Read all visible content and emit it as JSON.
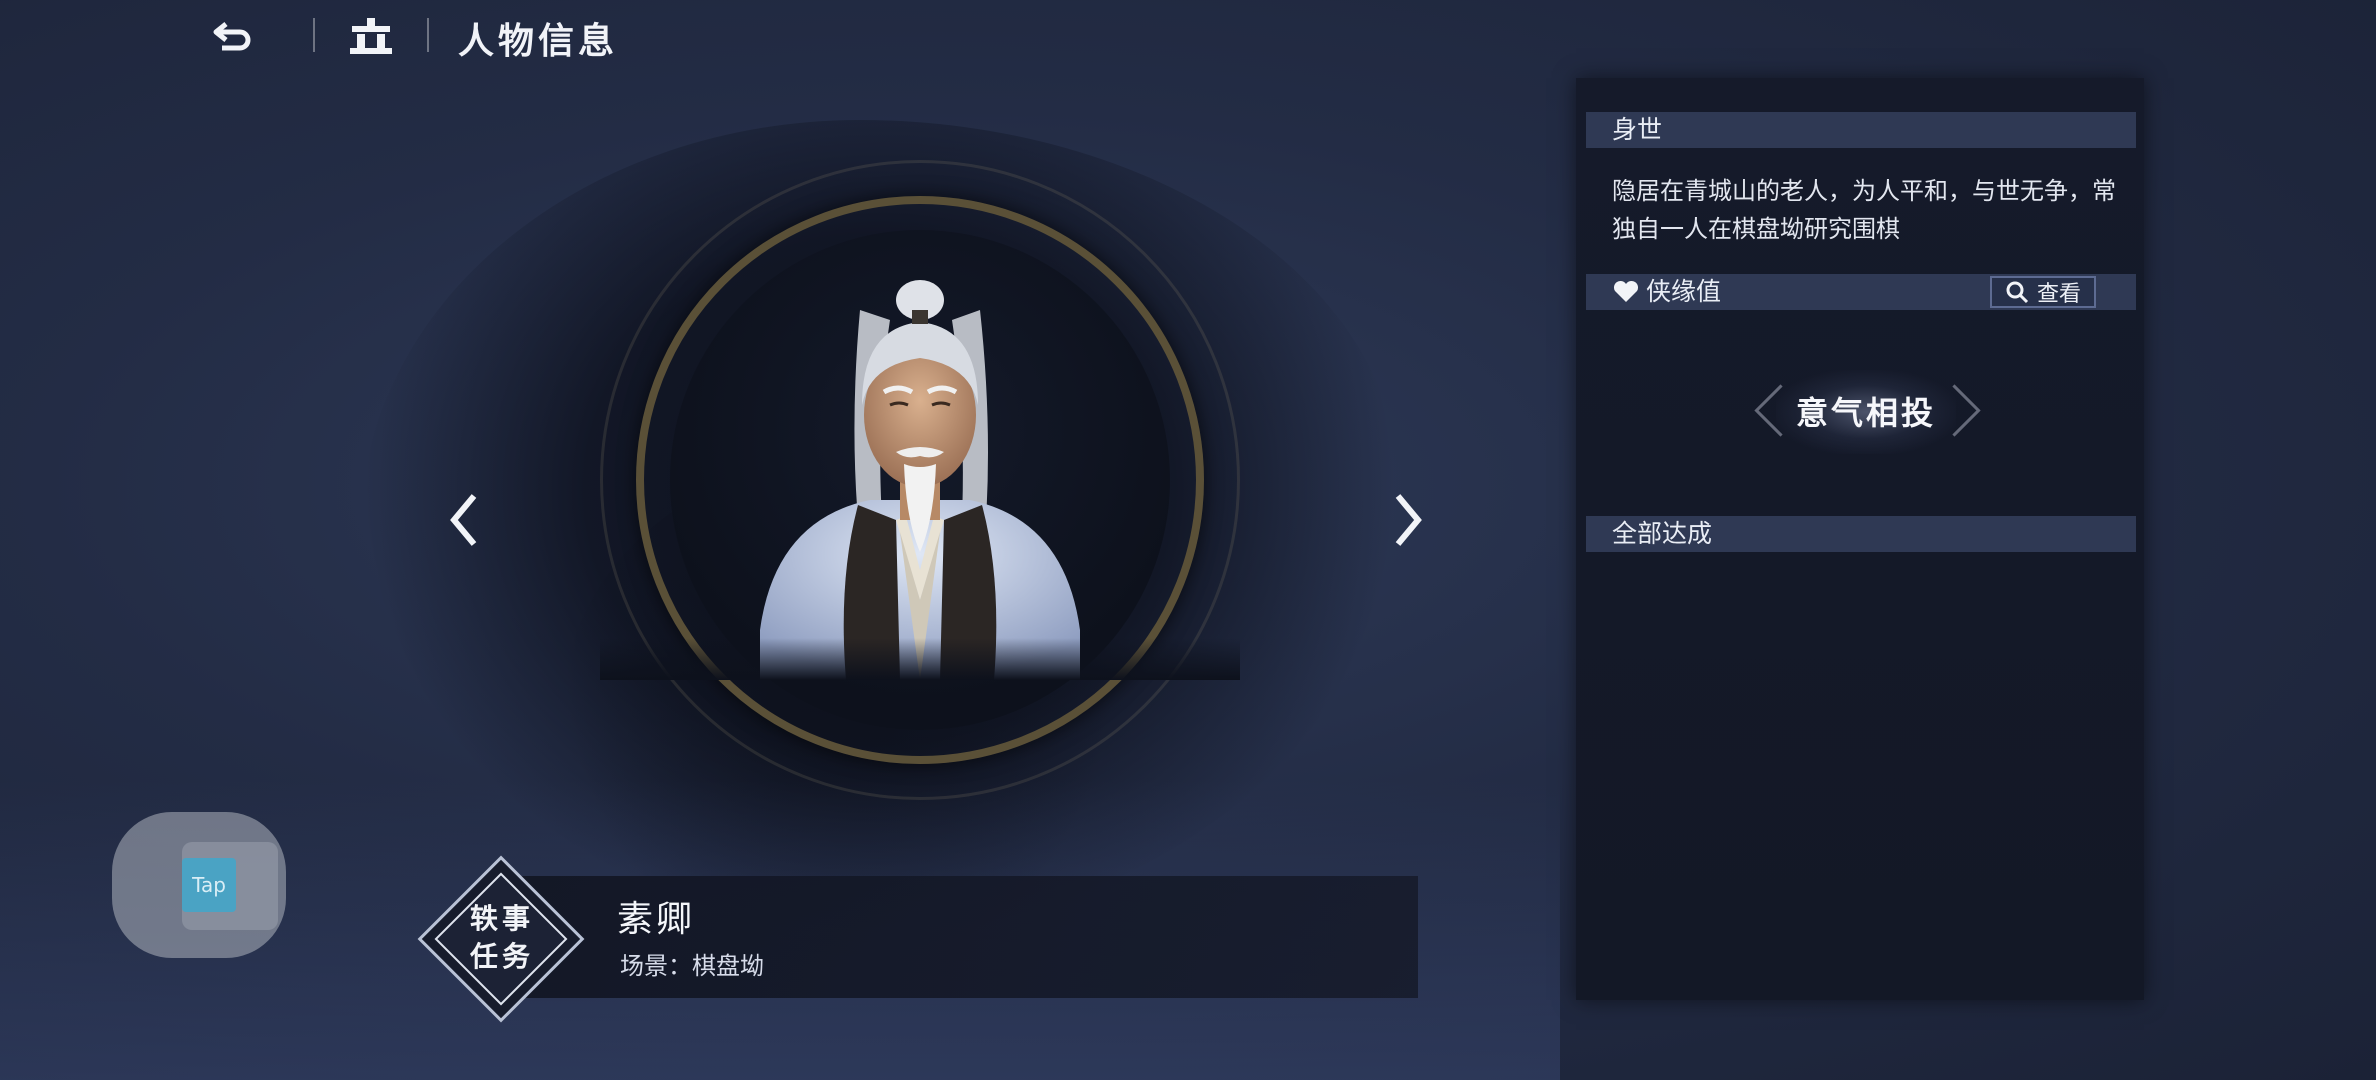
{
  "header": {
    "title": "人物信息"
  },
  "character": {
    "name": "素卿",
    "scene": "场景：棋盘坳"
  },
  "quest_badge": {
    "line1": "轶事",
    "line2": "任务"
  },
  "floating_button": {
    "label": "Tap"
  },
  "panel": {
    "bio_title": "身世",
    "bio_text": "隐居在青城山的老人，为人平和，与世无争，常独自一人在棋盘坳研究围棋",
    "affinity_label": "侠缘值",
    "view_label": "查看",
    "relationship": "意气相投",
    "completion_label": "全部达成"
  },
  "colors": {
    "accent": "#2f3954",
    "ring_gold": "#5a5037",
    "panel_bg": "#151a2a"
  }
}
